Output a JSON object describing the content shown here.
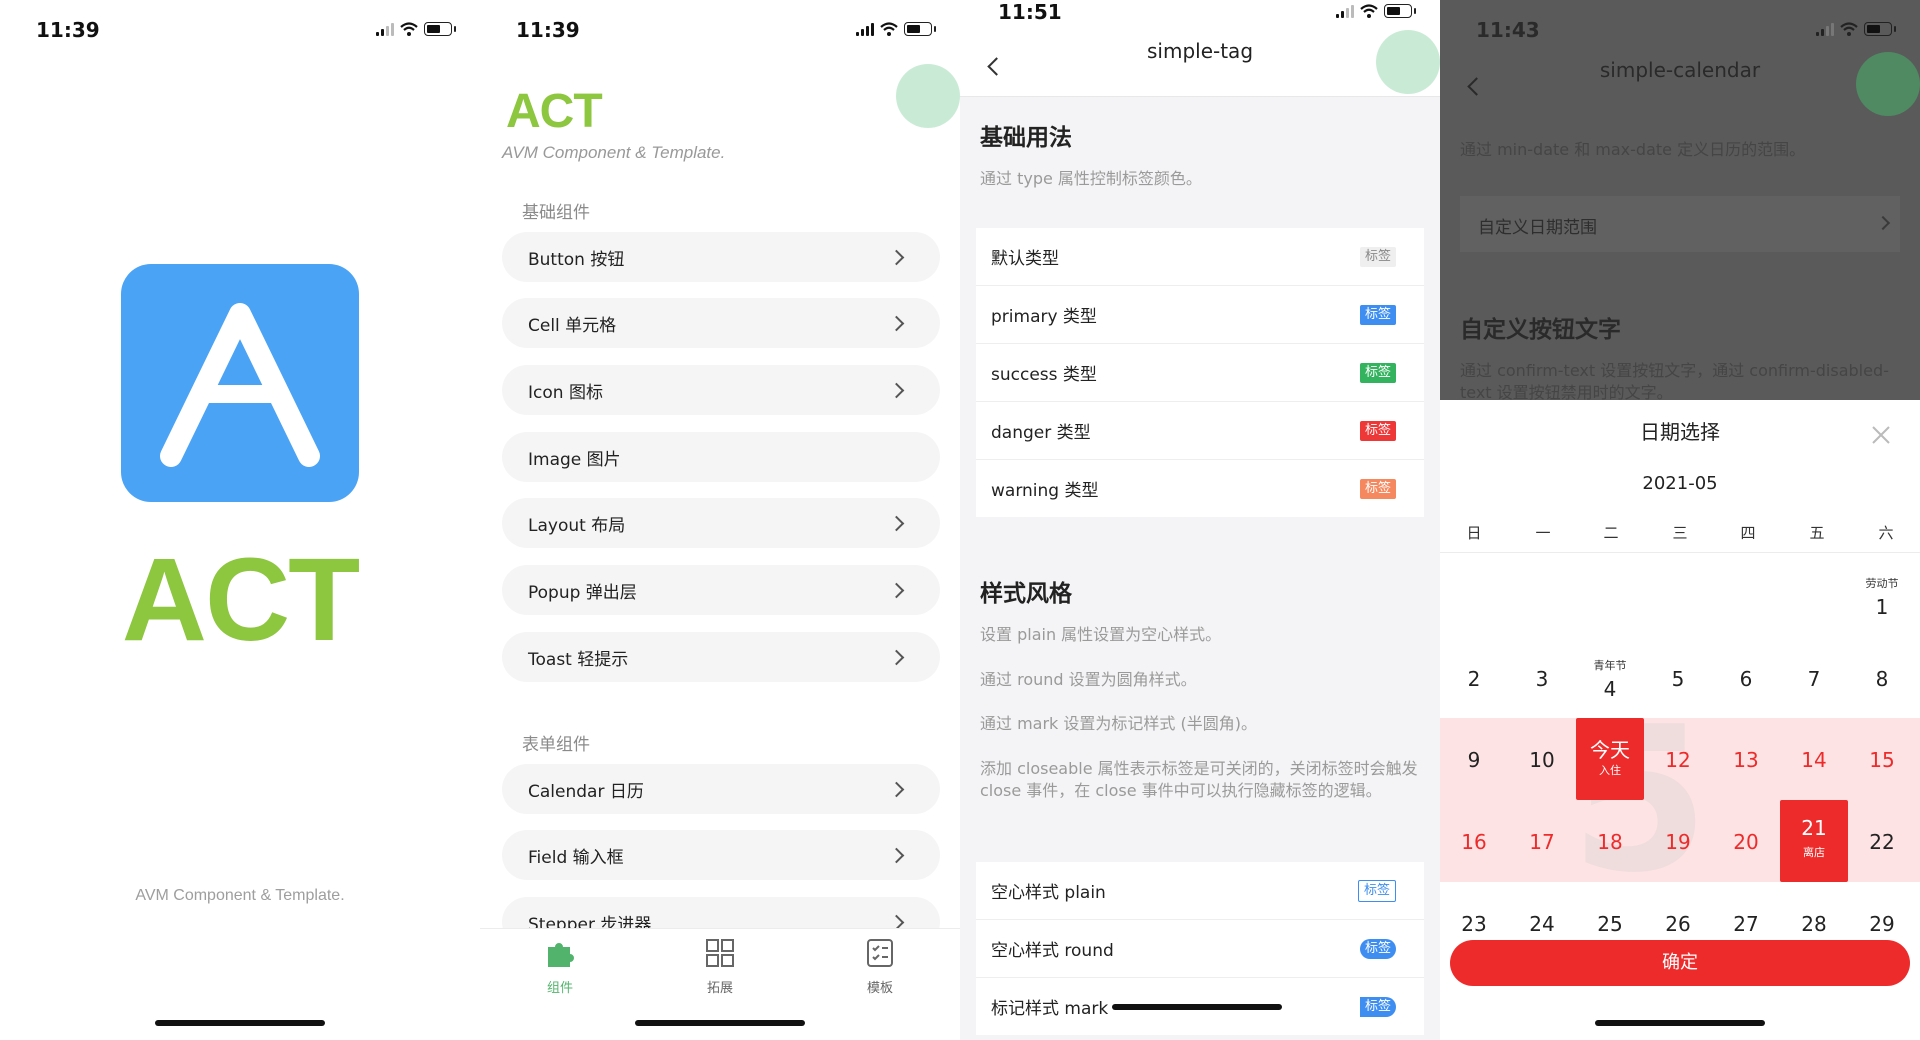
{
  "panel1": {
    "time": "11:39",
    "logo_letter": "A",
    "brand": "ACT",
    "footer": "AVM Component & Template.",
    "colors": {
      "logo_bg": "#4ba3f5",
      "brand_green": "#8dc63f"
    }
  },
  "panel2": {
    "time": "11:39",
    "brand": "ACT",
    "subtitle": "AVM Component & Template.",
    "section_basic": "基础组件",
    "basic_items": [
      {
        "label": "Button 按钮",
        "arrow": true
      },
      {
        "label": "Cell 单元格",
        "arrow": true
      },
      {
        "label": "Icon 图标",
        "arrow": true
      },
      {
        "label": "Image 图片",
        "arrow": false
      },
      {
        "label": "Layout 布局",
        "arrow": true
      },
      {
        "label": "Popup 弹出层",
        "arrow": true
      },
      {
        "label": "Toast 轻提示",
        "arrow": true
      }
    ],
    "section_form": "表单组件",
    "form_items": [
      {
        "label": "Calendar 日历"
      },
      {
        "label": "Field 输入框"
      },
      {
        "label": "Stepper 步进器"
      }
    ],
    "tabs": [
      {
        "label": "组件",
        "icon": "puzzle-icon",
        "active": true
      },
      {
        "label": "拓展",
        "icon": "grid-icon",
        "active": false
      },
      {
        "label": "模板",
        "icon": "checklist-icon",
        "active": false
      }
    ]
  },
  "panel3": {
    "time": "11:51",
    "title": "simple-tag",
    "sec1_title": "基础用法",
    "sec1_desc": "通过 type 属性控制标签颜色。",
    "type_rows": [
      {
        "label": "默认类型",
        "tag": "标签",
        "style": "default"
      },
      {
        "label": "primary 类型",
        "tag": "标签",
        "style": "primary"
      },
      {
        "label": "success 类型",
        "tag": "标签",
        "style": "success"
      },
      {
        "label": "danger 类型",
        "tag": "标签",
        "style": "danger"
      },
      {
        "label": "warning 类型",
        "tag": "标签",
        "style": "warning"
      }
    ],
    "sec2_title": "样式风格",
    "sec2_desc1": "设置 plain 属性设置为空心样式。",
    "sec2_desc2": "通过 round 设置为圆角样式。",
    "sec2_desc3": "通过 mark 设置为标记样式 (半圆角)。",
    "sec2_desc4": "添加 closeable 属性表示标签是可关闭的，关闭标签时会触发 close 事件，在 close 事件中可以执行隐藏标签的逻辑。",
    "style_rows": [
      {
        "label": "空心样式 plain",
        "tag": "标签",
        "style": "plain"
      },
      {
        "label": "空心样式 round",
        "tag": "标签",
        "style": "round"
      },
      {
        "label": "标记样式 mark",
        "tag": "标签",
        "style": "mark"
      }
    ]
  },
  "panel4": {
    "time": "11:43",
    "title": "simple-calendar",
    "bg_desc": "通过 min-date 和 max-date 定义日历的范围。",
    "bg_cell": "自定义日期范围",
    "bg_section": "自定义按钮文字",
    "bg_desc2": "通过 confirm-text 设置按钮文字，通过 confirm-disabled-text 设置按钮禁用时的文字。",
    "sheet_title": "日期选择",
    "month": "2021-05",
    "watermark": "5",
    "weekdays": [
      "日",
      "一",
      "二",
      "三",
      "四",
      "五",
      "六"
    ],
    "festival_1": "劳动节",
    "festival_4": "青年节",
    "start_label": "今天",
    "start_sub": "入住",
    "end_label": "21",
    "end_sub": "离店",
    "confirm": "确定",
    "colors": {
      "accent": "#ee2b2b",
      "range": "#fde3e3"
    }
  }
}
